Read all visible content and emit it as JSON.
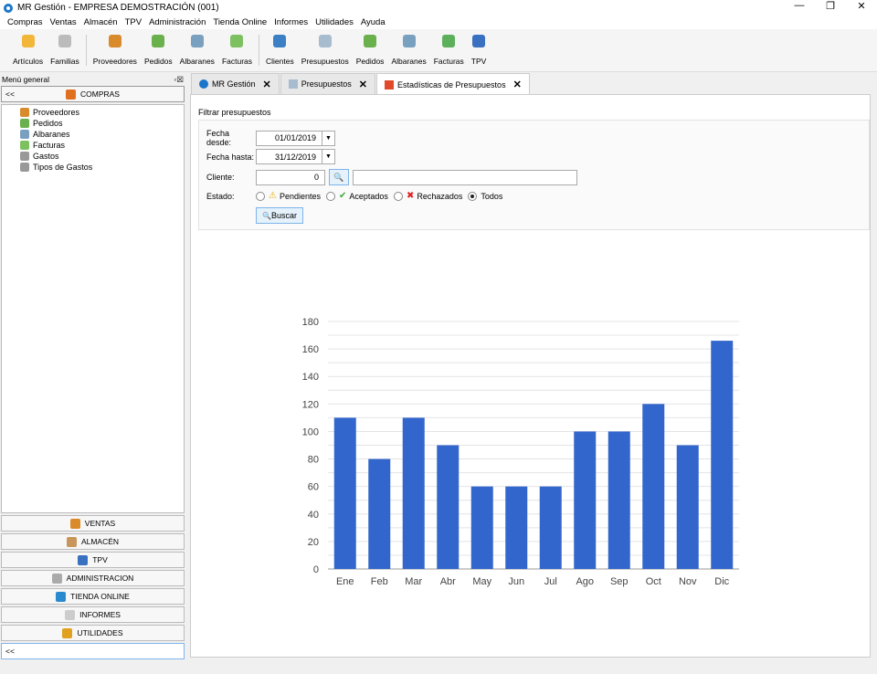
{
  "window": {
    "title": "MR Gestión - EMPRESA DEMOSTRACIÓN (001)",
    "controls": [
      "—",
      "❐",
      "✕"
    ]
  },
  "menu": [
    "Compras",
    "Ventas",
    "Almacén",
    "TPV",
    "Administración",
    "Tienda Online",
    "Informes",
    "Utilidades",
    "Ayuda"
  ],
  "toolbar": [
    {
      "label": "Artículos",
      "color": "#f2b63a"
    },
    {
      "label": "Familias",
      "color": "#bbbbbb"
    },
    null,
    {
      "label": "Proveedores",
      "color": "#d98a2b"
    },
    {
      "label": "Pedidos",
      "color": "#6ab04c"
    },
    {
      "label": "Albaranes",
      "color": "#7aa0c0"
    },
    {
      "label": "Facturas",
      "color": "#7cc060"
    },
    null,
    {
      "label": "Clientes",
      "color": "#3b7fc4"
    },
    {
      "label": "Presupuestos",
      "color": "#a8bcd0"
    },
    {
      "label": "Pedidos",
      "color": "#6ab04c"
    },
    {
      "label": "Albaranes",
      "color": "#7aa0c0"
    },
    {
      "label": "Facturas",
      "color": "#5cb05c"
    },
    {
      "label": "TPV",
      "color": "#3a70c0"
    }
  ],
  "sidebar": {
    "title": "Menú general",
    "collapse": "<<",
    "active_section": "COMPRAS",
    "tree": [
      {
        "label": "Proveedores",
        "color": "#d98a2b"
      },
      {
        "label": "Pedidos",
        "color": "#6ab04c"
      },
      {
        "label": "Albaranes",
        "color": "#7aa0c0"
      },
      {
        "label": "Facturas",
        "color": "#7cc060"
      },
      {
        "label": "Gastos",
        "color": "#999999"
      },
      {
        "label": "Tipos de Gastos",
        "color": "#999999"
      }
    ],
    "sections": [
      {
        "label": "VENTAS",
        "color": "#d98a2b"
      },
      {
        "label": "ALMACÉN",
        "color": "#c8955a"
      },
      {
        "label": "TPV",
        "color": "#3a70c0"
      },
      {
        "label": "ADMINISTRACION",
        "color": "#aaaaaa"
      },
      {
        "label": "TIENDA ONLINE",
        "color": "#2a8ad0"
      },
      {
        "label": "INFORMES",
        "color": "#cccccc"
      },
      {
        "label": "UTILIDADES",
        "color": "#e0a020"
      }
    ],
    "footer": "<<"
  },
  "tabs": [
    {
      "label": "MR Gestión",
      "active": false
    },
    {
      "label": "Presupuestos",
      "active": false
    },
    {
      "label": "Estadísticas de Presupuestos",
      "active": true
    }
  ],
  "filter": {
    "title": "Filtrar presupuestos",
    "fecha_desde_label": "Fecha desde:",
    "fecha_desde": "01/01/2019",
    "fecha_hasta_label": "Fecha hasta:",
    "fecha_hasta": "31/12/2019",
    "cliente_label": "Cliente:",
    "cliente_id": "0",
    "cliente_nombre": "",
    "estado_label": "Estado:",
    "estados": [
      {
        "label": "Pendientes",
        "icon": "⚠",
        "color": "#e8b000",
        "selected": false
      },
      {
        "label": "Aceptados",
        "icon": "✔",
        "color": "#3aa83a",
        "selected": false
      },
      {
        "label": "Rechazados",
        "icon": "✖",
        "color": "#e02020",
        "selected": false
      },
      {
        "label": "Todos",
        "icon": "",
        "color": "",
        "selected": true
      }
    ],
    "buscar": "Buscar"
  },
  "chart_data": {
    "type": "bar",
    "categories": [
      "Ene",
      "Feb",
      "Mar",
      "Abr",
      "May",
      "Jun",
      "Jul",
      "Ago",
      "Sep",
      "Oct",
      "Nov",
      "Dic"
    ],
    "values": [
      110,
      80,
      110,
      90,
      60,
      60,
      60,
      100,
      100,
      120,
      90,
      166
    ],
    "ylim": [
      0,
      180
    ],
    "yticks": [
      0,
      20,
      40,
      60,
      80,
      100,
      120,
      140,
      160,
      180
    ],
    "grid": true,
    "bar_color": "#3366cc",
    "title": "",
    "xlabel": "",
    "ylabel": ""
  }
}
